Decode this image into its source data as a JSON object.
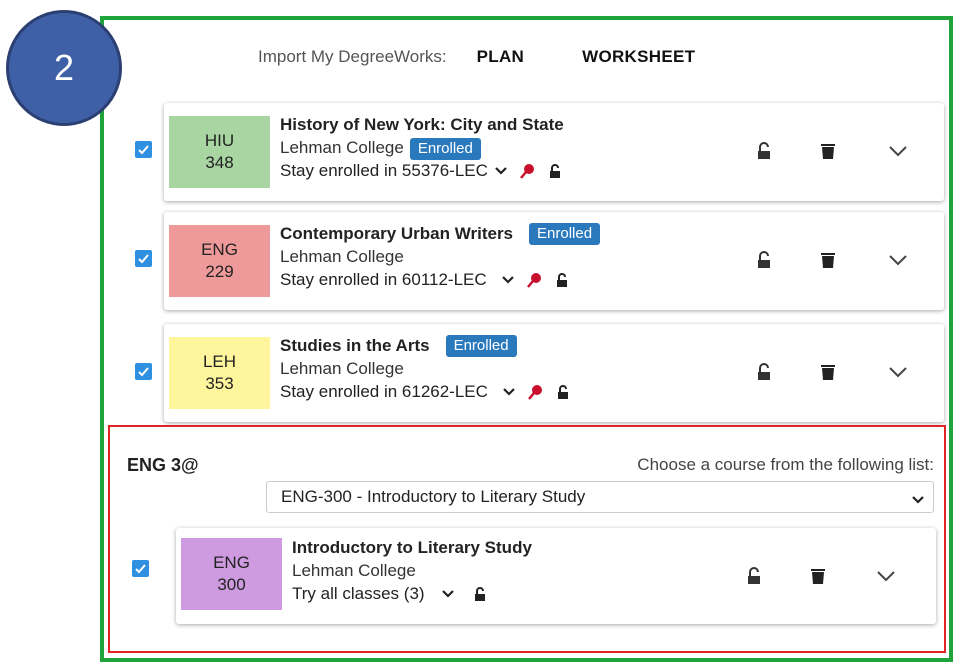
{
  "step_number": "2",
  "import": {
    "label": "Import My DegreeWorks:",
    "plan": "PLAN",
    "worksheet": "WORKSHEET"
  },
  "courses": [
    {
      "code_line1": "HIU",
      "code_line2": "348",
      "color": "#a8d5a2",
      "title": "History of New York: City and State",
      "college": "Lehman College",
      "status": "Enrolled",
      "section": "Stay enrolled in 55376-LEC",
      "checked": true
    },
    {
      "code_line1": "ENG",
      "code_line2": "229",
      "color": "#ef9a9a",
      "title": "Contemporary Urban Writers",
      "college": "Lehman College",
      "status": "Enrolled",
      "section": "Stay enrolled in 60112-LEC",
      "checked": true
    },
    {
      "code_line1": "LEH",
      "code_line2": "353",
      "color": "#fff59d",
      "title": "Studies in the Arts",
      "college": "Lehman College",
      "status": "Enrolled",
      "section": "Stay enrolled in 61262-LEC",
      "checked": true
    }
  ],
  "group": {
    "title": "ENG 3@",
    "prompt": "Choose a course from the following list:",
    "selected_option": "ENG-300 - Introductory to Literary Study",
    "course": {
      "code_line1": "ENG",
      "code_line2": "300",
      "color": "#cf9be0",
      "title": "Introductory to Literary Study",
      "college": "Lehman College",
      "section": "Try all classes (3)",
      "checked": true
    }
  }
}
